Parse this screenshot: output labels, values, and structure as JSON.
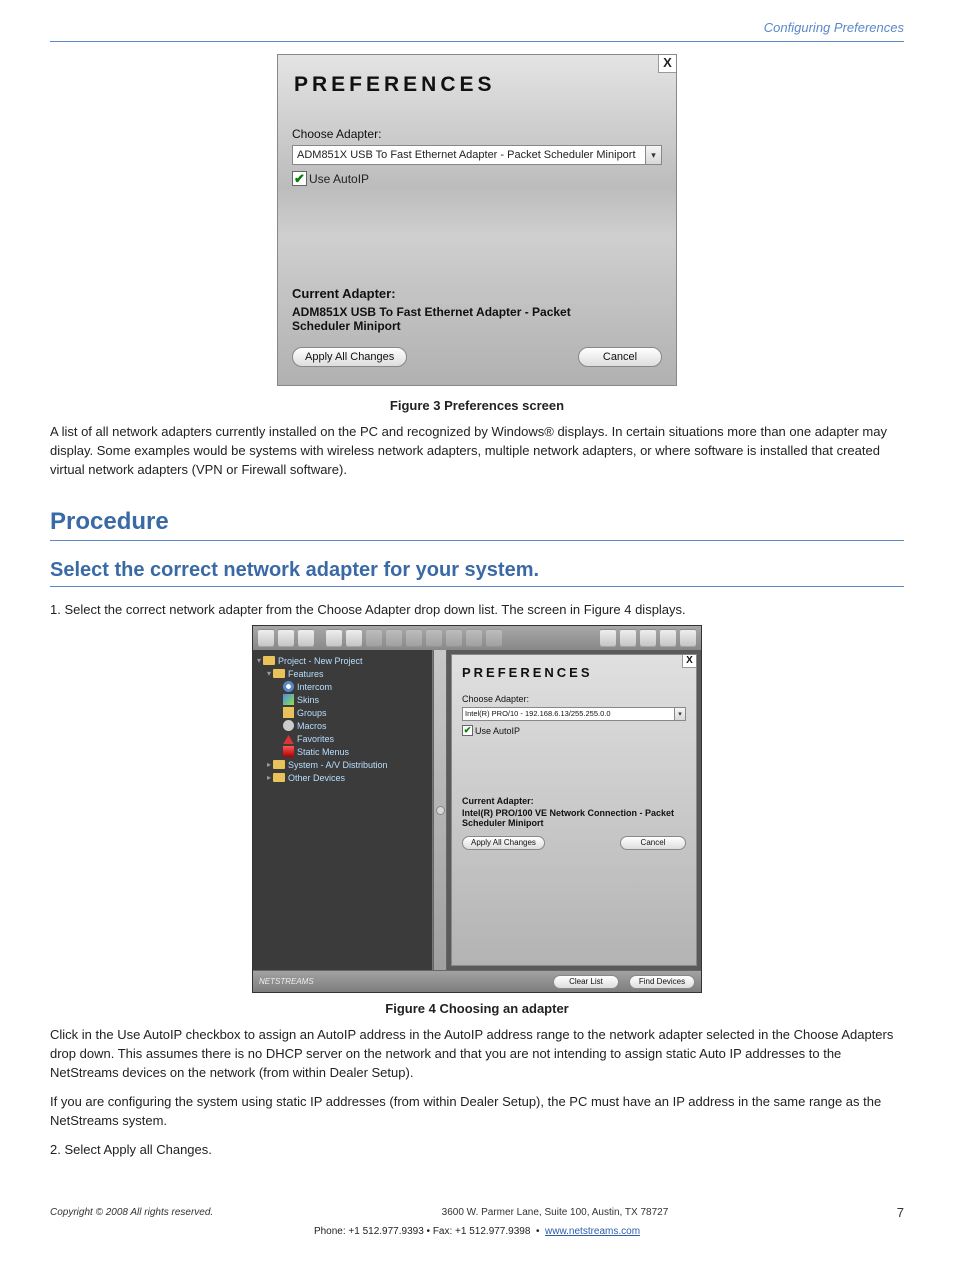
{
  "pageHeaderRight": "Configuring Preferences",
  "fig1": {
    "title": "PREFERENCES",
    "closeGlyph": "X",
    "chooseLabel": "Choose Adapter:",
    "adapterSelected": "ADM851X USB To Fast Ethernet Adapter - Packet Scheduler Miniport",
    "useAutoIPLabel": "Use AutoIP",
    "currentAdapterHeading": "Current Adapter:",
    "currentAdapterValue": "ADM851X USB To Fast Ethernet Adapter - Packet Scheduler Miniport",
    "applyBtn": "Apply All Changes",
    "cancelBtn": "Cancel",
    "caption": "Figure 3   Preferences screen"
  },
  "introAfterFig1": "A list of all network adapters currently installed on the PC and recognized by Windows® displays. In certain situations more than one adapter may display. Some examples would be systems with wireless network adapters, multiple network adapters, or where software is installed that created virtual network adapters (VPN or Firewall software).",
  "procHeading": "Procedure",
  "procSub": "Select the correct network adapter for your system.",
  "step1": "1. Select the correct network adapter from the Choose Adapter drop down list. The screen in Figure 4 displays.",
  "fig2": {
    "tree": {
      "root": "Project - New Project",
      "features": "Features",
      "items": [
        "Intercom",
        "Skins",
        "Groups",
        "Macros",
        "Favorites",
        "Static Menus"
      ],
      "system": "System - A/V Distribution",
      "other": "Other Devices"
    },
    "pref": {
      "title": "PREFERENCES",
      "closeGlyph": "X",
      "chooseLabel": "Choose Adapter:",
      "adapterSelected": "Intel(R) PRO/10 - 192.168.6.13/255.255.0.0",
      "useAutoIPLabel": "Use AutoIP",
      "currentAdapterHeading": "Current Adapter:",
      "currentAdapterValue": "Intel(R) PRO/100 VE Network Connection - Packet Scheduler Miniport",
      "applyBtn": "Apply All Changes",
      "cancelBtn": "Cancel"
    },
    "logo": "NETSTREAMS",
    "clearBtn": "Clear List",
    "findBtn": "Find Devices",
    "caption": "Figure 4   Choosing an adapter"
  },
  "belowFig2_p1": "Click in the Use AutoIP checkbox to assign an AutoIP address in the AutoIP address range to the network adapter selected in the Choose Adapters drop down. This assumes there is no DHCP server on the network and that you are not intending to assign static Auto IP addresses to the NetStreams devices on the network (from within Dealer Setup).",
  "belowFig2_p2": "If you are configuring the system using static IP addresses (from within Dealer Setup), the PC must have an IP address in the same range as the NetStreams system.",
  "step2": "2. Select Apply all Changes.",
  "footer": {
    "copyright": "Copyright © 2008 All rights reserved.",
    "centerLine1": "3600 W. Parmer Lane, Suite 100, Austin, TX 78727",
    "phone": "Phone: +1 512.977.9393 • Fax: +1 512.977.9398",
    "site": "www.netstreams.com",
    "pageNum": "7"
  }
}
